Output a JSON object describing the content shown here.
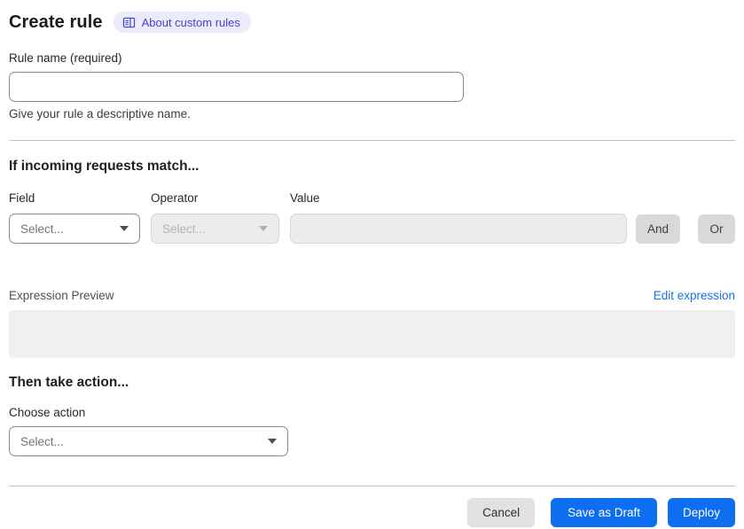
{
  "header": {
    "title": "Create rule",
    "about_badge": "About custom rules"
  },
  "rule_name": {
    "label": "Rule name (required)",
    "value": "",
    "placeholder": "",
    "helper": "Give your rule a descriptive name."
  },
  "match_section": {
    "heading": "If incoming requests match...",
    "field": {
      "label": "Field",
      "selected": "Select...",
      "disabled": false
    },
    "operator": {
      "label": "Operator",
      "selected": "Select...",
      "disabled": true
    },
    "value": {
      "label": "Value",
      "value": "",
      "disabled": true
    },
    "and_label": "And",
    "or_label": "Or"
  },
  "expression": {
    "label": "Expression Preview",
    "edit_link": "Edit expression",
    "content": ""
  },
  "action_section": {
    "heading": "Then take action...",
    "choose_label": "Choose action",
    "selected": "Select..."
  },
  "footer": {
    "cancel": "Cancel",
    "save_draft": "Save as Draft",
    "deploy": "Deploy"
  },
  "icons": {
    "book_icon": "book-icon",
    "chevron": "chevron-down-icon"
  },
  "colors": {
    "accent_blue": "#0d6ef2",
    "link_blue": "#1673e6",
    "badge_bg": "#ecebfb",
    "badge_text": "#3e45cf",
    "disabled_bg": "#ececec",
    "gray_button": "#d9d9d9"
  }
}
